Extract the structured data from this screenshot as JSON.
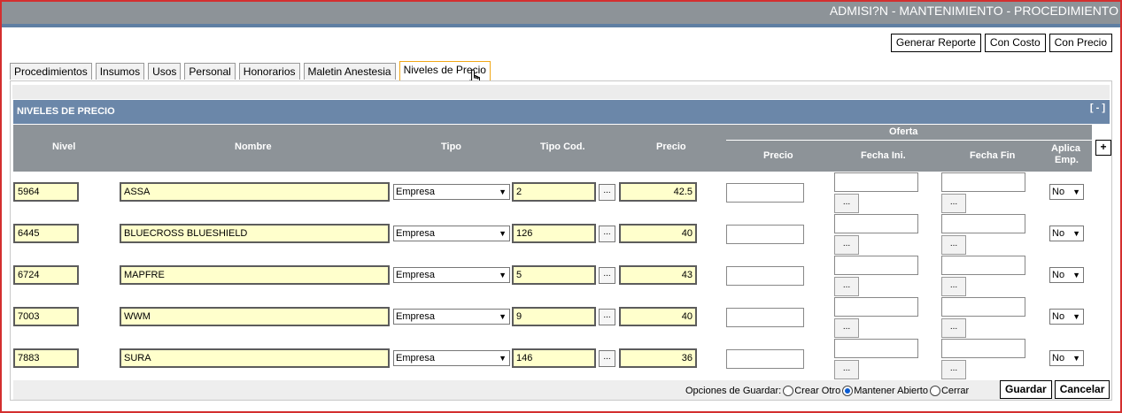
{
  "window": {
    "title": "ADMISI?N - MANTENIMIENTO - PROCEDIMIENTO"
  },
  "toolbar": {
    "generar_reporte": "Generar Reporte",
    "con_costo": "Con Costo",
    "con_precio": "Con Precio"
  },
  "tabs": [
    {
      "label": "Procedimientos",
      "active": false
    },
    {
      "label": "Insumos",
      "active": false
    },
    {
      "label": "Usos",
      "active": false
    },
    {
      "label": "Personal",
      "active": false
    },
    {
      "label": "Honorarios",
      "active": false
    },
    {
      "label": "Maletin Anestesia",
      "active": false
    },
    {
      "label": "Niveles de Precio",
      "active": true
    }
  ],
  "section": {
    "title": "NIVELES DE PRECIO",
    "collapse_label": "[ - ]"
  },
  "columns": {
    "nivel": "Nivel",
    "nombre": "Nombre",
    "tipo": "Tipo",
    "tipo_cod": "Tipo Cod.",
    "precio": "Precio",
    "oferta": "Oferta",
    "oferta_precio": "Precio",
    "fecha_ini": "Fecha Ini.",
    "fecha_fin": "Fecha Fin",
    "aplica_emp_1": "Aplica",
    "aplica_emp_2": "Emp.",
    "add_label": "+"
  },
  "lookup_label": "...",
  "rows": [
    {
      "nivel": "5964",
      "nombre": "ASSA",
      "tipo": "Empresa",
      "tipo_cod": "2",
      "precio": "42.5",
      "oferta_precio": "",
      "fecha_ini": "",
      "fecha_fin": "",
      "aplica": "No"
    },
    {
      "nivel": "6445",
      "nombre": "BLUECROSS BLUESHIELD",
      "tipo": "Empresa",
      "tipo_cod": "126",
      "precio": "40",
      "oferta_precio": "",
      "fecha_ini": "",
      "fecha_fin": "",
      "aplica": "No"
    },
    {
      "nivel": "6724",
      "nombre": "MAPFRE",
      "tipo": "Empresa",
      "tipo_cod": "5",
      "precio": "43",
      "oferta_precio": "",
      "fecha_ini": "",
      "fecha_fin": "",
      "aplica": "No"
    },
    {
      "nivel": "7003",
      "nombre": "WWM",
      "tipo": "Empresa",
      "tipo_cod": "9",
      "precio": "40",
      "oferta_precio": "",
      "fecha_ini": "",
      "fecha_fin": "",
      "aplica": "No"
    },
    {
      "nivel": "7883",
      "nombre": "SURA",
      "tipo": "Empresa",
      "tipo_cod": "146",
      "precio": "36",
      "oferta_precio": "",
      "fecha_ini": "",
      "fecha_fin": "",
      "aplica": "No"
    }
  ],
  "footer": {
    "options_label": "Opciones de Guardar:",
    "option_crear": "Crear Otro",
    "option_mantener": "Mantener Abierto",
    "option_cerrar": "Cerrar",
    "selected_option": "Mantener Abierto",
    "guardar": "Guardar",
    "cancelar": "Cancelar"
  },
  "colors": {
    "title_bar": "#8d9398",
    "section_header": "#6b87a9",
    "field_highlight": "#ffffcc",
    "active_tab_border": "#f0a818",
    "frame_border": "#d32f2f"
  }
}
